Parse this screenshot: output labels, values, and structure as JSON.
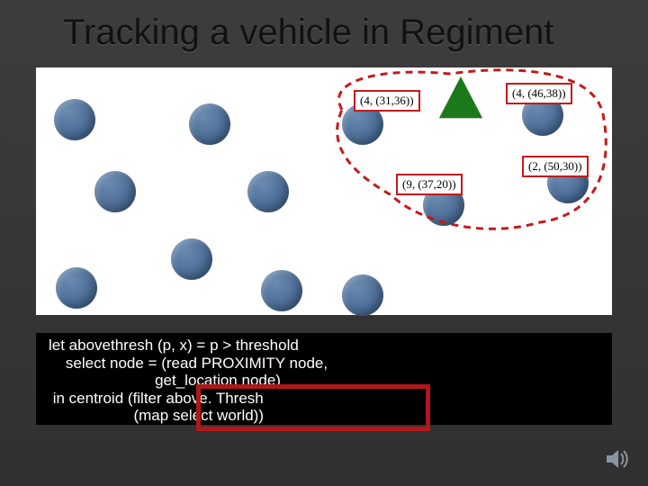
{
  "title": "Tracking a vehicle in Regiment",
  "labels": {
    "a": "(4, (31,36))",
    "b": "(4, (46,38))",
    "c": "(9, (37,20))",
    "d": "(2, (50,30))"
  },
  "code": {
    "l1": "let abovethresh (p, x) = p > threshold",
    "l2": "    select node = (read PROXIMITY node,",
    "l3": "                         get_location node)",
    "l4": " in centroid (filter above. Thresh",
    "l5": "                    (map select world))"
  },
  "icons": {
    "speaker": "speaker-icon"
  }
}
